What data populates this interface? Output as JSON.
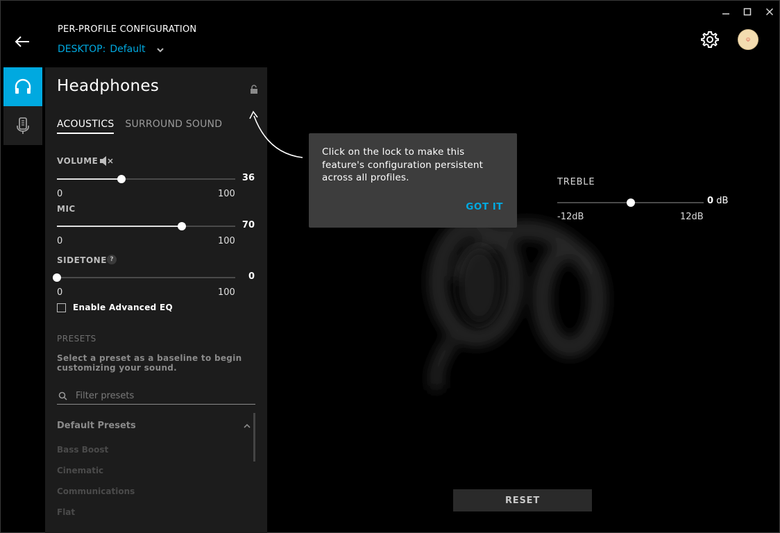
{
  "window": {
    "controls": {
      "minimize_icon": "minimize-icon",
      "maximize_icon": "maximize-icon",
      "close_icon": "close-icon"
    }
  },
  "header": {
    "title": "PER-PROFILE CONFIGURATION",
    "profile_prefix": "DESKTOP:",
    "profile_name": "Default",
    "back_icon": "back-arrow-icon",
    "settings_icon": "gear-icon",
    "avatar_icon": "avatar"
  },
  "rail": {
    "items": [
      {
        "icon": "headphones-icon",
        "active": true
      },
      {
        "icon": "microphone-icon",
        "active": false
      }
    ]
  },
  "panel": {
    "title": "Headphones",
    "tabs": [
      {
        "label": "ACOUSTICS",
        "active": true
      },
      {
        "label": "SURROUND SOUND",
        "active": false
      }
    ],
    "volume": {
      "label": "VOLUME",
      "value": "36",
      "min": "0",
      "max": "100",
      "fraction": 0.36
    },
    "mic": {
      "label": "MIC",
      "value": "70",
      "min": "0",
      "max": "100",
      "fraction": 0.7
    },
    "sidetone": {
      "label": "SIDETONE",
      "help": "?",
      "value": "0",
      "min": "0",
      "max": "100",
      "fraction": 0.0
    },
    "advanced_eq": {
      "label": "Enable Advanced EQ",
      "checked": false
    },
    "presets": {
      "label": "PRESETS",
      "description": "Select a preset as a baseline to begin customizing your sound.",
      "filter_placeholder": "Filter presets",
      "group_title": "Default Presets",
      "items": [
        "Bass Boost",
        "Cinematic",
        "Communications",
        "Flat"
      ]
    }
  },
  "tooltip": {
    "text": "Click on the lock to make this feature's configuration persistent across all profiles.",
    "action": "GOT IT"
  },
  "treble": {
    "label": "TREBLE",
    "value": "0",
    "unit": "dB",
    "min": "-12dB",
    "max": "12dB",
    "fraction": 0.5
  },
  "reset_label": "RESET",
  "colors": {
    "accent": "#00a9e0",
    "panel": "#1c1c1c",
    "tooltip": "#3d3d3d"
  }
}
